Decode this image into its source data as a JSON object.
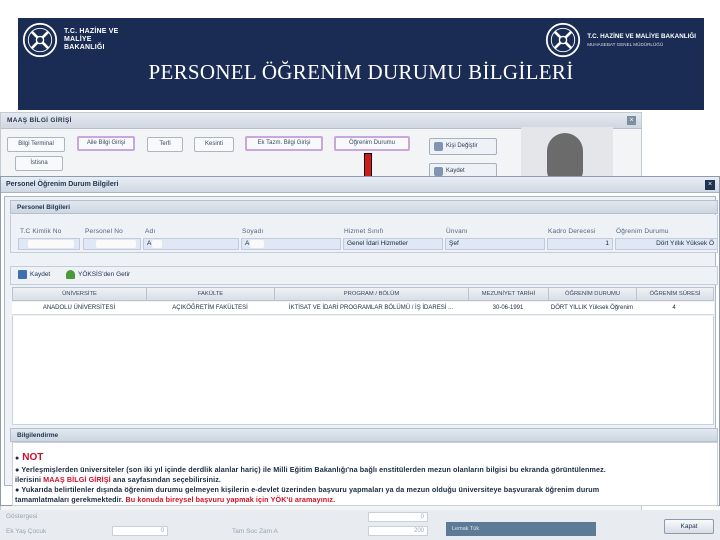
{
  "banner": {
    "title": "PERSONEL ÖĞRENİM DURUMU BİLGİLERİ",
    "left_logo": "T.C. HAZİNE VE MALİYE BAKANLIĞI",
    "right_logo_title": "T.C. HAZİNE VE MALİYE BAKANLIĞI",
    "right_logo_subtitle": "MUHASEBAT GENEL MÜDÜRLÜĞÜ",
    "color": "#1b2c54"
  },
  "back_form": {
    "title": "MAAŞ BİLGİ GİRİŞİ",
    "buttons": [
      "Bilgi Terminal",
      "Aile Bilgi Girişi",
      "Terfi",
      "Kesinti",
      "Ek Tazm. Bilgi Girişi",
      "Öğrenim Durumu",
      "İstisna"
    ],
    "side_buttons": [
      "Kişi Değiştir",
      "Kaydet"
    ],
    "bottom_labels": [
      "Göstergesi",
      "Ek Yaş Çocuk",
      "Tam Soc Zam A",
      "Lemak Tük"
    ],
    "bottom_values": [
      "0",
      "0",
      "0",
      "200"
    ]
  },
  "dialog": {
    "title": "Personel Öğrenim Durum Bilgileri",
    "personel_panel": "Personel Bilgileri",
    "labels": {
      "tc": "T.C Kimlik No",
      "personel_no": "Personel No",
      "adi": "Adı",
      "soyadi": "Soyadı",
      "hizmet_sinifi": "Hizmet Sınıfı",
      "unvani": "Ünvanı",
      "kadro_derecesi": "Kadro Derecesi",
      "ogrenim_durumu": "Öğrenim Durumu"
    },
    "values": {
      "adi": "A",
      "soyadi": "A",
      "hizmet_sinifi": "Genel İdari Hizmetler",
      "unvani": "Şef",
      "kadro_derecesi": "1",
      "ogrenim_durumu": "Dört Yıllık Yüksek Ö"
    },
    "toolbar": {
      "kaydet": "Kaydet",
      "yoksis": "YÖKSİS'den Getir"
    },
    "grid": {
      "columns": [
        "ÜNİVERSİTE",
        "FAKÜLTE",
        "PROGRAM / BÖLÜM",
        "MEZUNİYET TARİHİ",
        "ÖĞRENİM DURUMU",
        "ÖĞRENİM SÜRESİ"
      ],
      "rows": [
        [
          "ANADOLU ÜNİVERSİTESİ",
          "AÇIKÖĞRETİM FAKÜLTESİ",
          "İKTİSAT VE İDARİ PROGRAMLAR BÖLÜMÜ / İŞ İDARESİ ...",
          "30-06-1991",
          "DÖRT YILLIK Yüksek Öğrenim",
          "4"
        ]
      ]
    },
    "info_panel": "Bilgilendirme",
    "note": {
      "title": "NOT",
      "line1": "Yerleşmişlerden üniversiteler (son iki yıl içinde derdlik alanlar hariç) ile Milli Eğitim Bakanlığı'na bağlı enstitülerden mezun olanların bilgisi bu ekranda görüntülenmez.",
      "line2_a": "ilerisini ",
      "line2_red": "MAAŞ BİLGİ GİRİŞİ",
      "line2_b": " ana sayfasından seçebilirsiniz.",
      "line3": "Yukarıda belirtilenler dışında öğrenim durumu gelmeyen kişilerin e-devlet üzerinden başvuru yapmaları ya da mezun olduğu üniversiteye başvurarak öğrenim durum",
      "line4_a": "tamamlatmaları gerekmektedir. ",
      "line4_red": "Bu konuda bireysel başvuru yapmak için YÖK'ü aramayınız."
    },
    "close_button": "Kapat"
  }
}
